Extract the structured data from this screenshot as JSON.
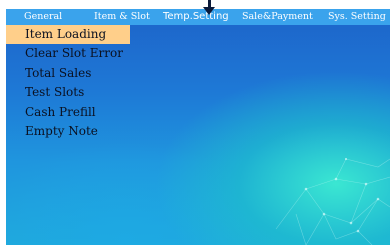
{
  "menu": {
    "tabs": [
      {
        "label": "General"
      },
      {
        "label": "Item & Slot"
      },
      {
        "label": "Temp.Setting"
      },
      {
        "label": "Sale&Payment"
      },
      {
        "label": "Sys. Setting"
      }
    ]
  },
  "dropdown": {
    "items": [
      {
        "label": "Item Loading",
        "selected": true
      },
      {
        "label": "Clear Slot Error"
      },
      {
        "label": "Total Sales"
      },
      {
        "label": "Test Slots"
      },
      {
        "label": "Cash Prefill"
      },
      {
        "label": "Empty Note"
      }
    ]
  },
  "colors": {
    "menubar": "#3aa3ec",
    "selected_item": "#ffcf8a",
    "panel_top": "#1d63c9",
    "glow": "#3cebd2"
  },
  "icons": {
    "pointer": "arrow-down-icon"
  }
}
